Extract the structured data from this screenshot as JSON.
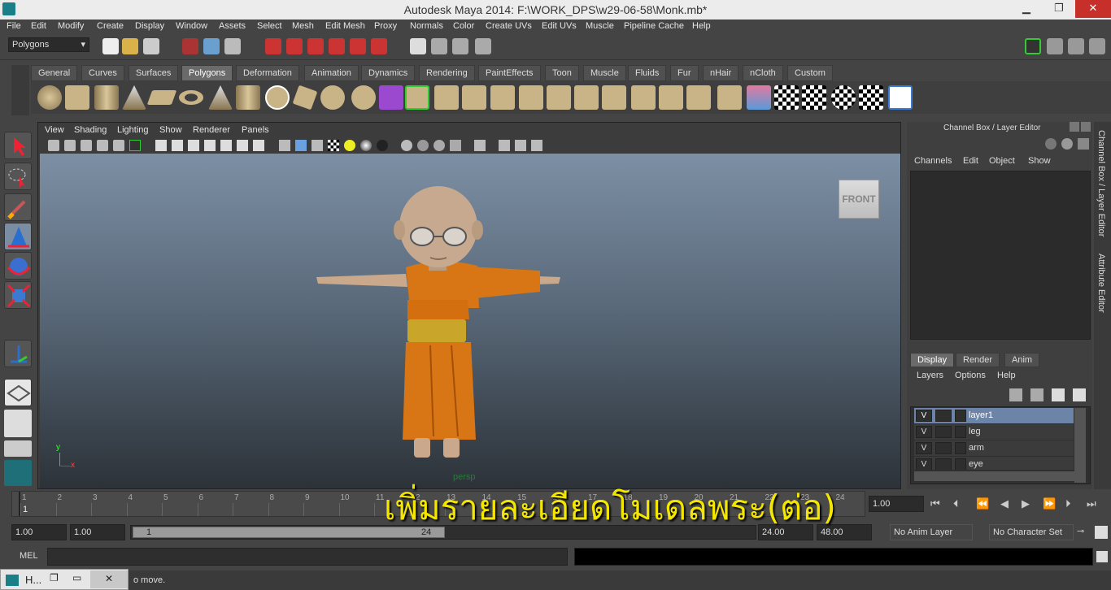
{
  "window": {
    "title": "Autodesk Maya 2014: F:\\WORK_DPS\\w29-06-58\\Monk.mb*",
    "minimize": "▁",
    "restore": "❐",
    "close": "✕"
  },
  "menubar": [
    "File",
    "Edit",
    "Modify",
    "Create",
    "Display",
    "Window",
    "Assets",
    "Select",
    "Mesh",
    "Edit Mesh",
    "Proxy",
    "Normals",
    "Color",
    "Create UVs",
    "Edit UVs",
    "Muscle",
    "Pipeline Cache",
    "Help"
  ],
  "statusline": {
    "menuset": "Polygons"
  },
  "shelf_tabs": [
    "General",
    "Curves",
    "Surfaces",
    "Polygons",
    "Deformation",
    "Animation",
    "Dynamics",
    "Rendering",
    "PaintEffects",
    "Toon",
    "Muscle",
    "Fluids",
    "Fur",
    "nHair",
    "nCloth",
    "Custom"
  ],
  "shelf_active": "Polygons",
  "viewport": {
    "menu": [
      "View",
      "Shading",
      "Lighting",
      "Show",
      "Renderer",
      "Panels"
    ],
    "camera_label": "persp",
    "viewcube": "FRONT",
    "axis_y": "y",
    "axis_x": "x"
  },
  "channel_box": {
    "title": "Channel Box / Layer Editor",
    "menu": [
      "Channels",
      "Edit",
      "Object",
      "Show"
    ]
  },
  "layer_editor": {
    "tabs": [
      "Display",
      "Render",
      "Anim"
    ],
    "active_tab": "Display",
    "menu": [
      "Layers",
      "Options",
      "Help"
    ],
    "layers": [
      {
        "v": "V",
        "name": "layer1",
        "selected": true
      },
      {
        "v": "V",
        "name": "leg",
        "selected": false
      },
      {
        "v": "V",
        "name": "arm",
        "selected": false
      },
      {
        "v": "V",
        "name": "eye",
        "selected": false
      }
    ]
  },
  "side_tabs": [
    "Channel Box / Layer Editor",
    "Attribute Editor"
  ],
  "timeline": {
    "ticks": [
      "1",
      "2",
      "3",
      "4",
      "5",
      "6",
      "7",
      "8",
      "9",
      "10",
      "11",
      "12",
      "13",
      "14",
      "15",
      "16",
      "17",
      "18",
      "19",
      "20",
      "21",
      "22",
      "23",
      "24"
    ],
    "current_frame": "1",
    "current_time_field": "1.00"
  },
  "range": {
    "start_field": "1.00",
    "playback_start": "1.00",
    "slider_start": "1",
    "slider_end": "24",
    "playback_end": "24.00",
    "end_field": "48.00",
    "anim_layer": "No Anim Layer",
    "character_set": "No Character Set"
  },
  "cmdline": {
    "label": "MEL"
  },
  "helpline": {
    "text": "o move."
  },
  "minimized_window": {
    "label": "H..."
  },
  "caption": "เพิ่มรายละเอียดโมเดลพระ(ต่อ)",
  "colors": {
    "viewport_top": "#7d8fa4",
    "viewport_bottom": "#2c3238",
    "robe": "#d87514",
    "belt": "#c9a52a",
    "skin": "#c7a98f",
    "caption": "#f3e600",
    "selected_layer": "#6b84a7"
  }
}
